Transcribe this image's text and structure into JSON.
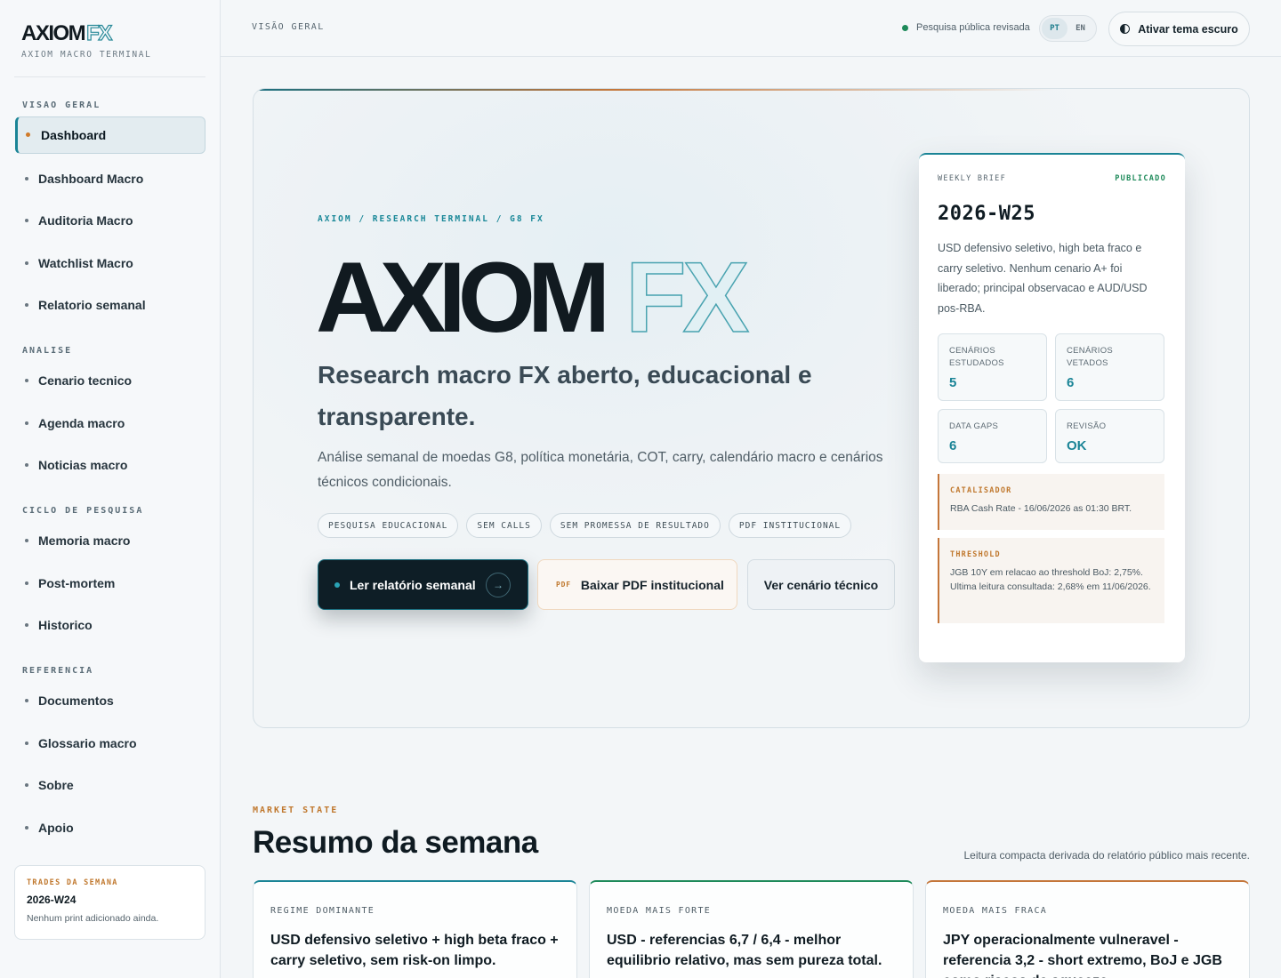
{
  "brand": {
    "name": "AXIOM",
    "accent": "FX",
    "subtitle": "AXIOM MACRO TERMINAL"
  },
  "sidebar": {
    "sections": [
      {
        "title": "VISAO GERAL",
        "items": [
          "Dashboard",
          "Dashboard Macro",
          "Auditoria Macro",
          "Watchlist Macro",
          "Relatorio semanal"
        ]
      },
      {
        "title": "ANALISE",
        "items": [
          "Cenario tecnico",
          "Agenda macro",
          "Noticias macro"
        ]
      },
      {
        "title": "CICLO DE PESQUISA",
        "items": [
          "Memoria macro",
          "Post-mortem",
          "Historico"
        ]
      },
      {
        "title": "REFERENCIA",
        "items": [
          "Documentos",
          "Glossario macro",
          "Sobre",
          "Apoio"
        ]
      }
    ],
    "active_item": "Dashboard",
    "trades": {
      "label": "TRADES DA SEMANA",
      "week": "2026-W24",
      "note": "Nenhum print adicionado ainda."
    }
  },
  "topbar": {
    "breadcrumb": "VISÃO GERAL",
    "status": "Pesquisa pública revisada",
    "lang_pt": "PT",
    "lang_en": "EN",
    "theme_button": "Ativar tema escuro"
  },
  "hero": {
    "breadcrumb": "AXIOM / RESEARCH TERMINAL / G8 FX",
    "logo_main": "AXIOM",
    "logo_accent": "FX",
    "headline": "Research macro FX aberto, educacional e transparente.",
    "description": "Análise semanal de moedas G8, política monetária, COT, carry, calendário macro e cenários técnicos condicionais.",
    "chips": [
      "PESQUISA EDUCACIONAL",
      "SEM CALLS",
      "SEM PROMESSA DE RESULTADO",
      "PDF INSTITUCIONAL"
    ],
    "cta_primary": "Ler relatório semanal",
    "cta_pdf_tag": "PDF",
    "cta_pdf": "Baixar PDF institucional",
    "cta_tech": "Ver cenário técnico"
  },
  "brief": {
    "label": "WEEKLY BRIEF",
    "status": "PUBLICADO",
    "week": "2026-W25",
    "summary": "USD defensivo seletivo, high beta fraco e carry seletivo. Nenhum cenario A+ foi liberado; principal observacao e AUD/USD pos-RBA.",
    "metrics": [
      {
        "label": "CENÁRIOS ESTUDADOS",
        "value": "5"
      },
      {
        "label": "CENÁRIOS VETADOS",
        "value": "6"
      },
      {
        "label": "DATA GAPS",
        "value": "6"
      },
      {
        "label": "REVISÃO",
        "value": "OK"
      }
    ],
    "catalyst": {
      "label": "CATALISADOR",
      "text": "RBA Cash Rate - 16/06/2026 as 01:30 BRT."
    },
    "threshold": {
      "label": "THRESHOLD",
      "text": "JGB 10Y em relacao ao threshold BoJ: 2,75%. Ultima leitura consultada: 2,68% em 11/06/2026."
    }
  },
  "market_state": {
    "label": "MARKET STATE",
    "title": "Resumo da semana",
    "aside": "Leitura compacta derivada do relatório público mais recente.",
    "cards": [
      {
        "label": "REGIME DOMINANTE",
        "text": "USD defensivo seletivo + high beta fraco + carry seletivo, sem risk-on limpo.",
        "accent": "#1a8496"
      },
      {
        "label": "MOEDA MAIS FORTE",
        "text": "USD - referencias 6,7 / 6,4 - melhor equilibrio relativo, mas sem pureza total.",
        "accent": "#1e8a5a"
      },
      {
        "label": "MOEDA MAIS FRACA",
        "text": "JPY operacionalmente vulneravel - referencia 3,2 - short extremo, BoJ e JGB como riscos de squeeze.",
        "accent": "#c4763a"
      }
    ]
  },
  "colors": {
    "accent": "#1a8496",
    "warm": "#c4763a",
    "success": "#1e8a5a",
    "ink": "#0f1b22"
  }
}
